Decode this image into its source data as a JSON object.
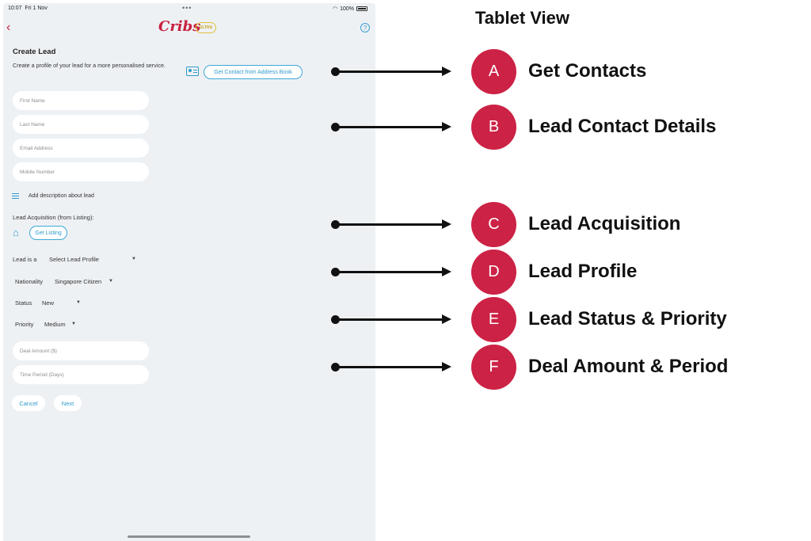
{
  "status_bar": {
    "time": "10:07",
    "date": "Fri 1 Nov",
    "battery": "100%"
  },
  "header": {
    "logo": "Cribs",
    "badge": "ULTRA"
  },
  "form": {
    "title": "Create Lead",
    "subtitle": "Create a profile of your lead for a more personalised service.",
    "get_contact_label": "Get Contact from Address Book",
    "fields": {
      "first_name": "First Name",
      "last_name": "Last Name",
      "email": "Email Address",
      "mobile": "Mobile Number",
      "deal_amount": "Deal Amount ($)",
      "time_period": "Time Period (Days)"
    },
    "description_label": "Add description about lead",
    "acquisition_label": "Lead Acquisition (from Listing):",
    "get_listing_label": "Get Listing",
    "lead_is_label": "Lead is a",
    "lead_is_value": "Select Lead Profile",
    "nationality_label": "Nationality",
    "nationality_value": "Singapore Citizen",
    "status_label": "Status",
    "status_value": "New",
    "priority_label": "Priority",
    "priority_value": "Medium",
    "cancel_label": "Cancel",
    "next_label": "Next"
  },
  "annotations": {
    "heading": "Tablet View",
    "items": [
      {
        "letter": "A",
        "label": "Get Contacts"
      },
      {
        "letter": "B",
        "label": "Lead Contact Details"
      },
      {
        "letter": "C",
        "label": "Lead Acquisition"
      },
      {
        "letter": "D",
        "label": "Lead Profile"
      },
      {
        "letter": "E",
        "label": "Lead Status & Priority"
      },
      {
        "letter": "F",
        "label": "Deal Amount & Period"
      }
    ]
  },
  "colors": {
    "accent": "#cc2245",
    "link": "#2e9bcc",
    "panel": "#eef1f4"
  }
}
